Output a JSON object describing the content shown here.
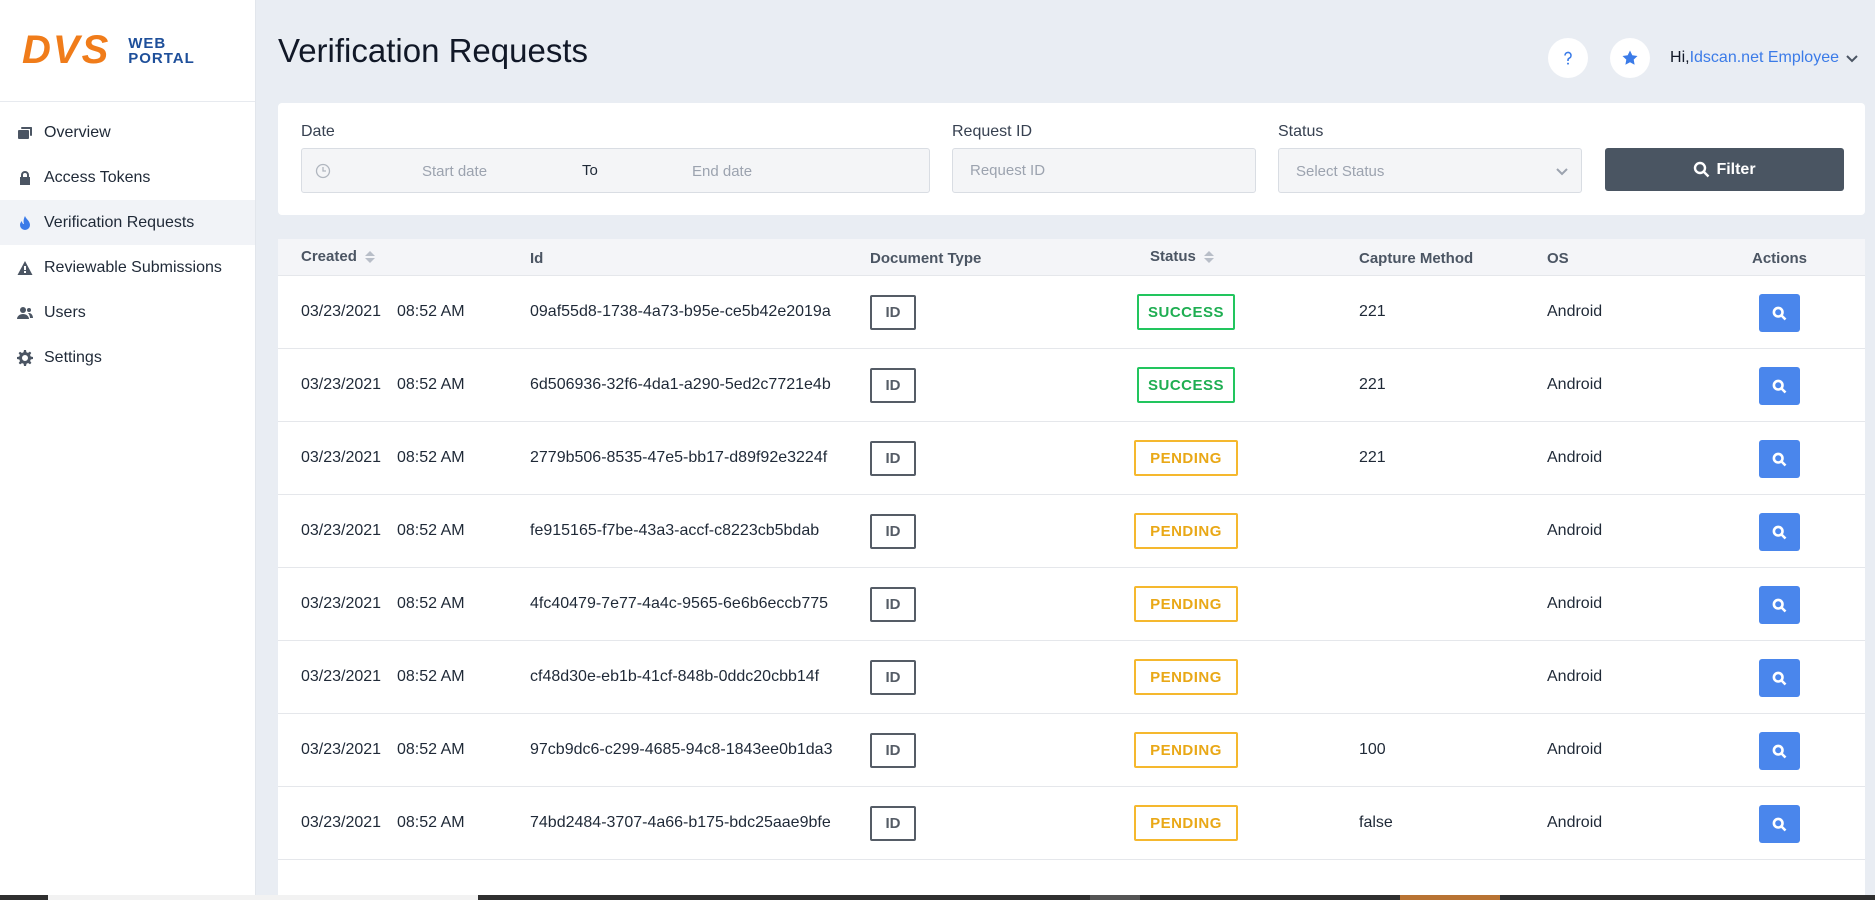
{
  "brand": {
    "main": "DVS",
    "sub_line1": "WEB",
    "sub_line2": "PORTAL"
  },
  "sidebar": {
    "items": [
      {
        "label": "Overview",
        "icon": "overview-icon",
        "active": false
      },
      {
        "label": "Access Tokens",
        "icon": "lock-icon",
        "active": false
      },
      {
        "label": "Verification Requests",
        "icon": "flame-icon",
        "active": true
      },
      {
        "label": "Reviewable Submissions",
        "icon": "warning-icon",
        "active": false
      },
      {
        "label": "Users",
        "icon": "users-icon",
        "active": false
      },
      {
        "label": "Settings",
        "icon": "gear-icon",
        "active": false
      }
    ]
  },
  "header": {
    "title": "Verification Requests",
    "greeting": "Hi,",
    "user_name": "Idscan.net Employee",
    "help_icon": "question-icon",
    "star_icon": "star-icon"
  },
  "filters": {
    "date_label": "Date",
    "start_placeholder": "Start date",
    "to_label": "To",
    "end_placeholder": "End date",
    "request_id_label": "Request ID",
    "request_id_placeholder": "Request ID",
    "status_label": "Status",
    "status_placeholder": "Select Status",
    "filter_button": "Filter"
  },
  "table": {
    "columns": {
      "created": "Created",
      "id": "Id",
      "document_type": "Document Type",
      "status": "Status",
      "capture_method": "Capture Method",
      "os": "OS",
      "actions": "Actions"
    },
    "rows": [
      {
        "date": "03/23/2021",
        "time": "08:52 AM",
        "id": "09af55d8-1738-4a73-b95e-ce5b42e2019a",
        "doc": "ID",
        "status": "SUCCESS",
        "capture": "221",
        "os": "Android"
      },
      {
        "date": "03/23/2021",
        "time": "08:52 AM",
        "id": "6d506936-32f6-4da1-a290-5ed2c7721e4b",
        "doc": "ID",
        "status": "SUCCESS",
        "capture": "221",
        "os": "Android"
      },
      {
        "date": "03/23/2021",
        "time": "08:52 AM",
        "id": "2779b506-8535-47e5-bb17-d89f92e3224f",
        "doc": "ID",
        "status": "PENDING",
        "capture": "221",
        "os": "Android"
      },
      {
        "date": "03/23/2021",
        "time": "08:52 AM",
        "id": "fe915165-f7be-43a3-accf-c8223cb5bdab",
        "doc": "ID",
        "status": "PENDING",
        "capture": "",
        "os": "Android"
      },
      {
        "date": "03/23/2021",
        "time": "08:52 AM",
        "id": "4fc40479-7e77-4a4c-9565-6e6b6eccb775",
        "doc": "ID",
        "status": "PENDING",
        "capture": "",
        "os": "Android"
      },
      {
        "date": "03/23/2021",
        "time": "08:52 AM",
        "id": "cf48d30e-eb1b-41cf-848b-0ddc20cbb14f",
        "doc": "ID",
        "status": "PENDING",
        "capture": "",
        "os": "Android"
      },
      {
        "date": "03/23/2021",
        "time": "08:52 AM",
        "id": "97cb9dc6-c299-4685-94c8-1843ee0b1da3",
        "doc": "ID",
        "status": "PENDING",
        "capture": "100",
        "os": "Android"
      },
      {
        "date": "03/23/2021",
        "time": "08:52 AM",
        "id": "74bd2484-3707-4a66-b175-bdc25aae9bfe",
        "doc": "ID",
        "status": "PENDING",
        "capture": "false",
        "os": "Android"
      }
    ]
  },
  "colors": {
    "accent": "#3b7be8",
    "brand_orange": "#f07c1a",
    "success": "#22c55e",
    "pending": "#f5b82e",
    "filter_button": "#4a5562",
    "action_button": "#4a86ec"
  }
}
